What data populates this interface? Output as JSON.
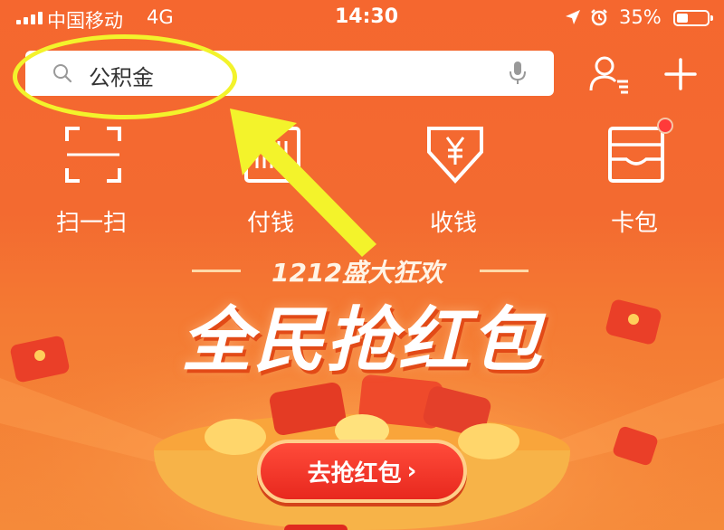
{
  "status_bar": {
    "carrier": "中国移动",
    "network": "4G",
    "time": "14:30",
    "battery": "35%",
    "battery_level": 0.35,
    "icons": [
      "signal-icon",
      "location-icon",
      "alarm-icon",
      "battery-icon"
    ]
  },
  "search": {
    "text": "公积金",
    "icons": [
      "search-icon",
      "microphone-icon"
    ]
  },
  "header_actions": {
    "icons": [
      "contacts-icon",
      "plus-icon"
    ]
  },
  "shortcuts": [
    {
      "label": "扫一扫",
      "icon": "scan-icon"
    },
    {
      "label": "付钱",
      "icon": "pay-icon"
    },
    {
      "label": "收钱",
      "icon": "collect-money-icon"
    },
    {
      "label": "卡包",
      "icon": "card-wallet-icon"
    }
  ],
  "banner": {
    "subtitle": "1212盛大狂欢",
    "title": "全民抢红包",
    "button_label": "去抢红包",
    "button_icon": "chevron-right-icon"
  },
  "annotation": {
    "highlight_color": "#f3f32b",
    "arrow_color": "#f3f32b"
  },
  "colors": {
    "background": "#f36a30",
    "white": "#ffffff",
    "badge_red": "#ff3a3a",
    "button_red": "#e8281e"
  }
}
